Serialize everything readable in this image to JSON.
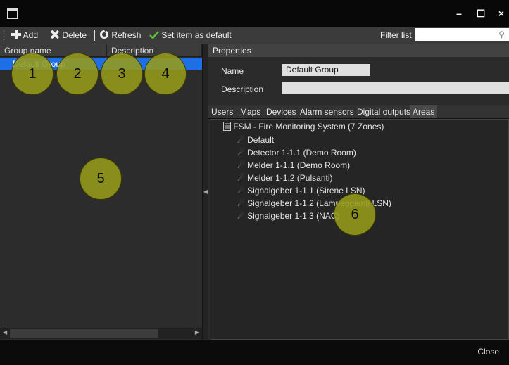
{
  "window": {
    "minimize_glyph": "–",
    "maximize_glyph": "☐",
    "close_glyph": "×"
  },
  "toolbar": {
    "add_label": "Add",
    "add_icon": "plus-icon",
    "delete_label": "Delete",
    "delete_icon": "x-icon",
    "refresh_label": "Refresh",
    "refresh_icon": "refresh-icon",
    "default_label": "Set item as default",
    "default_icon": "checkmark-icon",
    "filter_label": "Filter list",
    "filter_value": "",
    "filter_icon": "search-icon"
  },
  "group_list": {
    "columns": [
      "Group name",
      "Description"
    ],
    "rows": [
      {
        "name": "Default Group",
        "description": ""
      }
    ]
  },
  "properties": {
    "header": "Properties",
    "name_label": "Name",
    "name_value": "Default Group",
    "description_label": "Description",
    "description_value": ""
  },
  "tabs": [
    "Users",
    "Maps",
    "Devices",
    "Alarm sensors",
    "Digital outputs",
    "Areas"
  ],
  "active_tab": "Areas",
  "areas": {
    "root": "FSM - Fire Monitoring System (7 Zones)",
    "children": [
      "Default",
      "Detector 1-1.1 (Demo Room)",
      "Melder 1-1.1 (Demo Room)",
      "Melder 1-1.2 (Pulsanti)",
      "Signalgeber 1-1.1 (Sirene LSN)",
      "Signalgeber 1-1.2 (Lampeggianti LSN)",
      "Signalgeber 1-1.3 (NAC)"
    ]
  },
  "footer": {
    "close_label": "Close"
  },
  "callouts": [
    "1",
    "2",
    "3",
    "4",
    "5",
    "6"
  ],
  "colors": {
    "selection": "#1d6fe6",
    "callout": "#9b9b19",
    "check": "#5bbf3a"
  }
}
